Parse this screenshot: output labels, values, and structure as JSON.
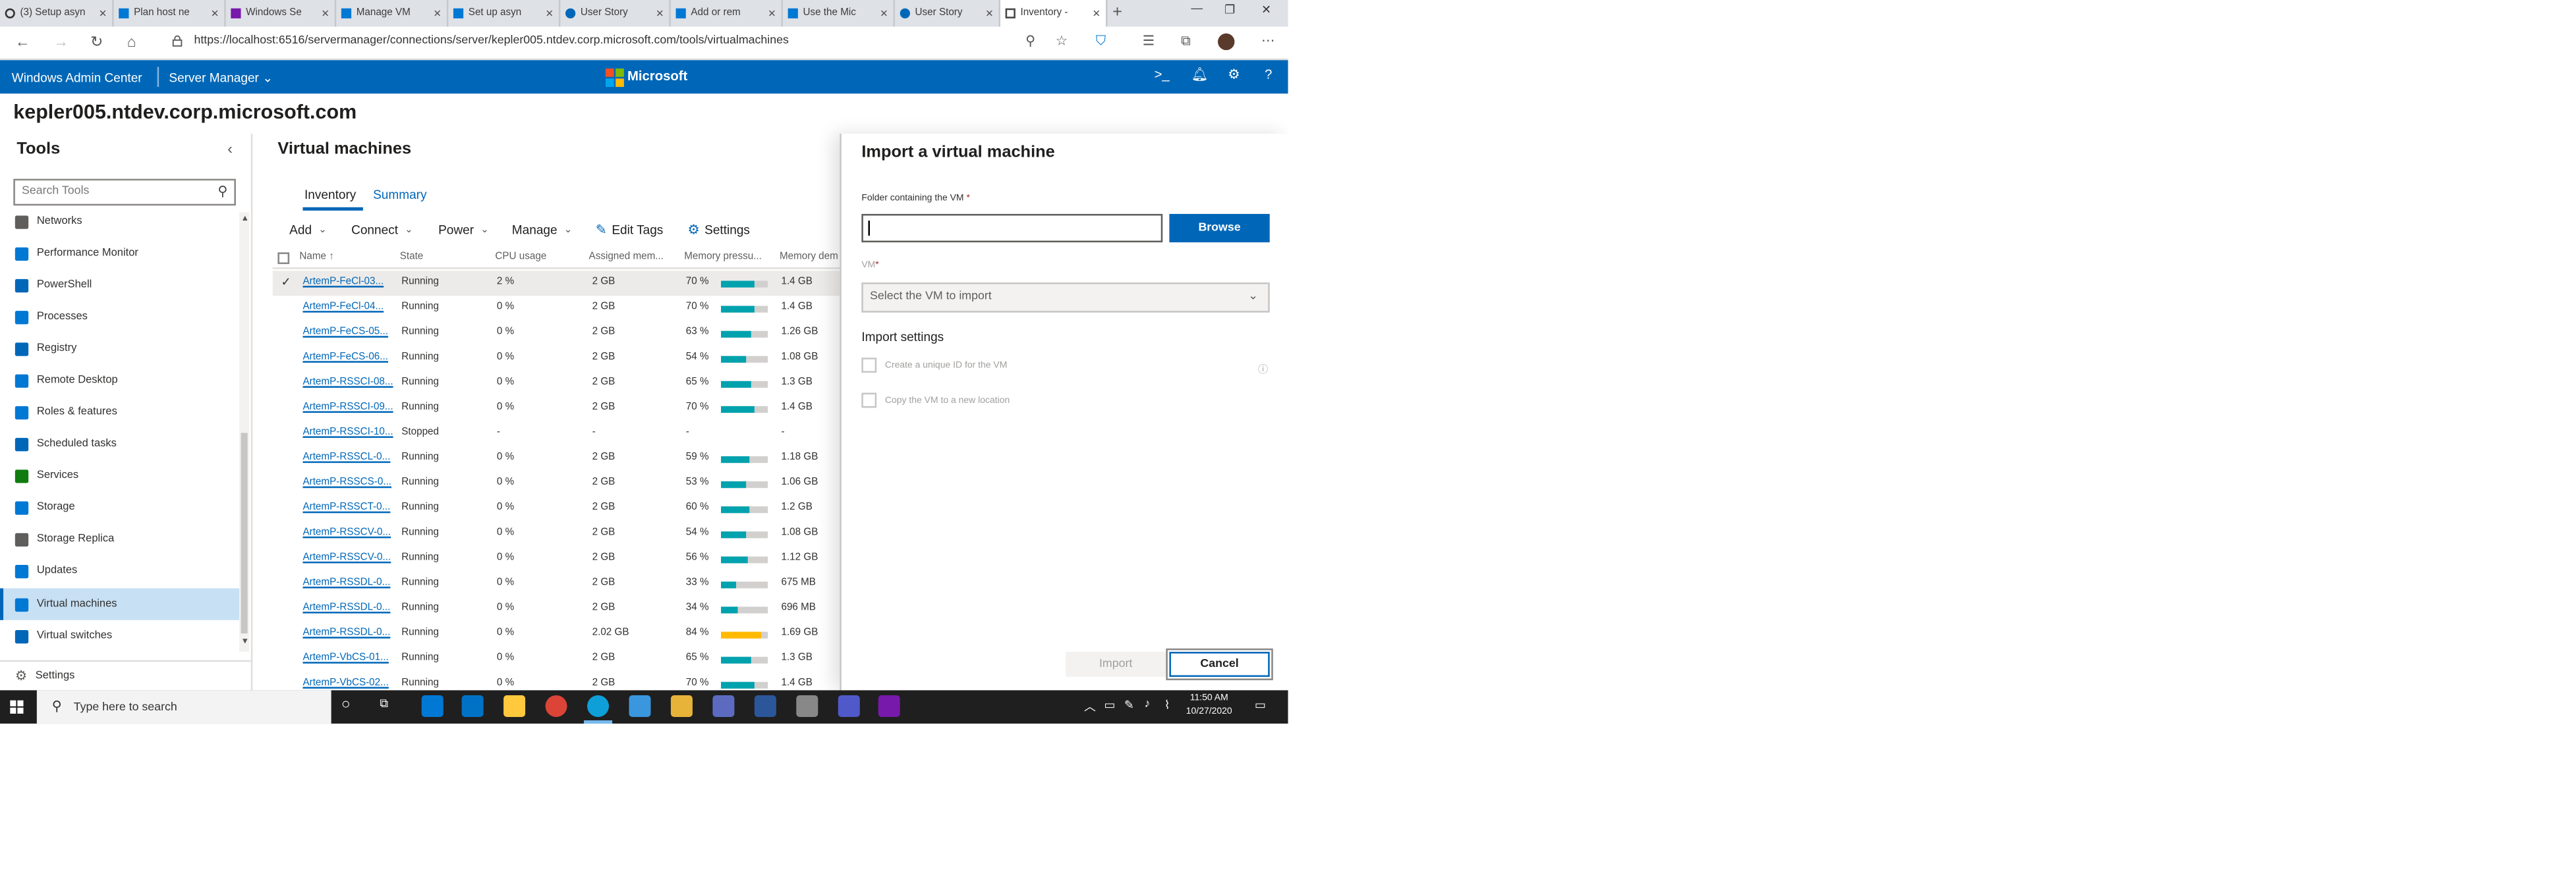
{
  "browser": {
    "tabs": [
      {
        "label": "(3) Setup asyn"
      },
      {
        "label": "Plan host ne"
      },
      {
        "label": "Windows Se"
      },
      {
        "label": "Manage VM"
      },
      {
        "label": "Set up asyn"
      },
      {
        "label": "User Story"
      },
      {
        "label": "Add or rem"
      },
      {
        "label": "Use the Mic"
      },
      {
        "label": "User Story"
      },
      {
        "label": "Inventory -"
      }
    ],
    "url": "https://localhost:6516/servermanager/connections/server/kepler005.ntdev.corp.microsoft.com/tools/virtualmachines"
  },
  "header": {
    "app_title": "Windows Admin Center",
    "server_manager": "Server Manager",
    "microsoft": "Microsoft"
  },
  "server_name": "kepler005.ntdev.corp.microsoft.com",
  "tools": {
    "title": "Tools",
    "search_placeholder": "Search Tools",
    "items": [
      {
        "label": "Networks",
        "icon": "network-icon",
        "color": "#605e5c"
      },
      {
        "label": "Performance Monitor",
        "icon": "performance-monitor-icon",
        "color": "#0078d4"
      },
      {
        "label": "PowerShell",
        "icon": "powershell-icon",
        "color": "#0067b8"
      },
      {
        "label": "Processes",
        "icon": "processes-icon",
        "color": "#0078d4"
      },
      {
        "label": "Registry",
        "icon": "registry-icon",
        "color": "#0067b8"
      },
      {
        "label": "Remote Desktop",
        "icon": "remote-desktop-icon",
        "color": "#0078d4"
      },
      {
        "label": "Roles & features",
        "icon": "roles-icon",
        "color": "#0078d4"
      },
      {
        "label": "Scheduled tasks",
        "icon": "scheduled-tasks-icon",
        "color": "#0067b8"
      },
      {
        "label": "Services",
        "icon": "services-icon",
        "color": "#107c10"
      },
      {
        "label": "Storage",
        "icon": "storage-icon",
        "color": "#0078d4"
      },
      {
        "label": "Storage Replica",
        "icon": "storage-replica-icon",
        "color": "#605e5c"
      },
      {
        "label": "Updates",
        "icon": "updates-icon",
        "color": "#0078d4"
      },
      {
        "label": "Virtual machines",
        "icon": "virtual-machines-icon",
        "color": "#0078d4"
      },
      {
        "label": "Virtual switches",
        "icon": "virtual-switches-icon",
        "color": "#0067b8"
      }
    ],
    "settings": "Settings"
  },
  "main": {
    "title": "Virtual machines",
    "tabs": [
      {
        "label": "Inventory"
      },
      {
        "label": "Summary"
      }
    ],
    "commands": {
      "add": "Add",
      "connect": "Connect",
      "power": "Power",
      "manage": "Manage",
      "edit_tags": "Edit Tags",
      "settings": "Settings"
    },
    "columns": [
      "Name ↑",
      "State",
      "CPU usage",
      "Assigned mem...",
      "Memory pressu...",
      "Memory dem"
    ],
    "rows": [
      {
        "name": "ArtemP-FeCl-03...",
        "state": "Running",
        "cpu": "2 %",
        "mem": "2 GB",
        "pressure": "70 %",
        "pfrac": 0.7,
        "demand": "1.4 GB",
        "color": "#00a2ad"
      },
      {
        "name": "ArtemP-FeCl-04...",
        "state": "Running",
        "cpu": "0 %",
        "mem": "2 GB",
        "pressure": "70 %",
        "pfrac": 0.7,
        "demand": "1.4 GB",
        "color": "#00a2ad"
      },
      {
        "name": "ArtemP-FeCS-05...",
        "state": "Running",
        "cpu": "0 %",
        "mem": "2 GB",
        "pressure": "63 %",
        "pfrac": 0.63,
        "demand": "1.26 GB",
        "color": "#00a2ad"
      },
      {
        "name": "ArtemP-FeCS-06...",
        "state": "Running",
        "cpu": "0 %",
        "mem": "2 GB",
        "pressure": "54 %",
        "pfrac": 0.54,
        "demand": "1.08 GB",
        "color": "#00a2ad"
      },
      {
        "name": "ArtemP-RSSCI-08...",
        "state": "Running",
        "cpu": "0 %",
        "mem": "2 GB",
        "pressure": "65 %",
        "pfrac": 0.65,
        "demand": "1.3 GB",
        "color": "#00a2ad"
      },
      {
        "name": "ArtemP-RSSCI-09...",
        "state": "Running",
        "cpu": "0 %",
        "mem": "2 GB",
        "pressure": "70 %",
        "pfrac": 0.7,
        "demand": "1.4 GB",
        "color": "#00a2ad"
      },
      {
        "name": "ArtemP-RSSCI-10...",
        "state": "Stopped",
        "cpu": "-",
        "mem": "-",
        "pressure": "-",
        "pfrac": null,
        "demand": "-",
        "color": "#00a2ad"
      },
      {
        "name": "ArtemP-RSSCL-0...",
        "state": "Running",
        "cpu": "0 %",
        "mem": "2 GB",
        "pressure": "59 %",
        "pfrac": 0.59,
        "demand": "1.18 GB",
        "color": "#00a2ad"
      },
      {
        "name": "ArtemP-RSSCS-0...",
        "state": "Running",
        "cpu": "0 %",
        "mem": "2 GB",
        "pressure": "53 %",
        "pfrac": 0.53,
        "demand": "1.06 GB",
        "color": "#00a2ad"
      },
      {
        "name": "ArtemP-RSSCT-0...",
        "state": "Running",
        "cpu": "0 %",
        "mem": "2 GB",
        "pressure": "60 %",
        "pfrac": 0.6,
        "demand": "1.2 GB",
        "color": "#00a2ad"
      },
      {
        "name": "ArtemP-RSSCV-0...",
        "state": "Running",
        "cpu": "0 %",
        "mem": "2 GB",
        "pressure": "54 %",
        "pfrac": 0.54,
        "demand": "1.08 GB",
        "color": "#00a2ad"
      },
      {
        "name": "ArtemP-RSSCV-0...",
        "state": "Running",
        "cpu": "0 %",
        "mem": "2 GB",
        "pressure": "56 %",
        "pfrac": 0.56,
        "demand": "1.12 GB",
        "color": "#00a2ad"
      },
      {
        "name": "ArtemP-RSSDL-0...",
        "state": "Running",
        "cpu": "0 %",
        "mem": "2 GB",
        "pressure": "33 %",
        "pfrac": 0.33,
        "demand": "675 MB",
        "color": "#00a2ad"
      },
      {
        "name": "ArtemP-RSSDL-0...",
        "state": "Running",
        "cpu": "0 %",
        "mem": "2 GB",
        "pressure": "34 %",
        "pfrac": 0.34,
        "demand": "696 MB",
        "color": "#00a2ad"
      },
      {
        "name": "ArtemP-RSSDL-0...",
        "state": "Running",
        "cpu": "0 %",
        "mem": "2.02 GB",
        "pressure": "84 %",
        "pfrac": 0.84,
        "demand": "1.69 GB",
        "color": "#ffb900"
      },
      {
        "name": "ArtemP-VbCS-01...",
        "state": "Running",
        "cpu": "0 %",
        "mem": "2 GB",
        "pressure": "65 %",
        "pfrac": 0.65,
        "demand": "1.3 GB",
        "color": "#00a2ad"
      },
      {
        "name": "ArtemP-VbCS-02...",
        "state": "Running",
        "cpu": "0 %",
        "mem": "2 GB",
        "pressure": "70 %",
        "pfrac": 0.7,
        "demand": "1.4 GB",
        "color": "#00a2ad"
      }
    ]
  },
  "dialog": {
    "title": "Import a virtual machine",
    "folder_label": "Folder containing the VM",
    "folder_value": "",
    "browse": "Browse",
    "vm_label": "VM",
    "required_mark": "*",
    "vm_placeholder": "Select the VM to import",
    "import_settings": "Import settings",
    "unique_id": "Create a unique ID for the VM",
    "copy_vm": "Copy the VM to a new location",
    "import": "Import",
    "cancel": "Cancel"
  },
  "taskbar": {
    "search_placeholder": "Type here to search",
    "time": "11:50 AM",
    "date": "10/27/2020"
  },
  "colors": {
    "accent": "#0067b8",
    "pressure_normal": "#00a2ad",
    "pressure_warning": "#ffb900"
  }
}
